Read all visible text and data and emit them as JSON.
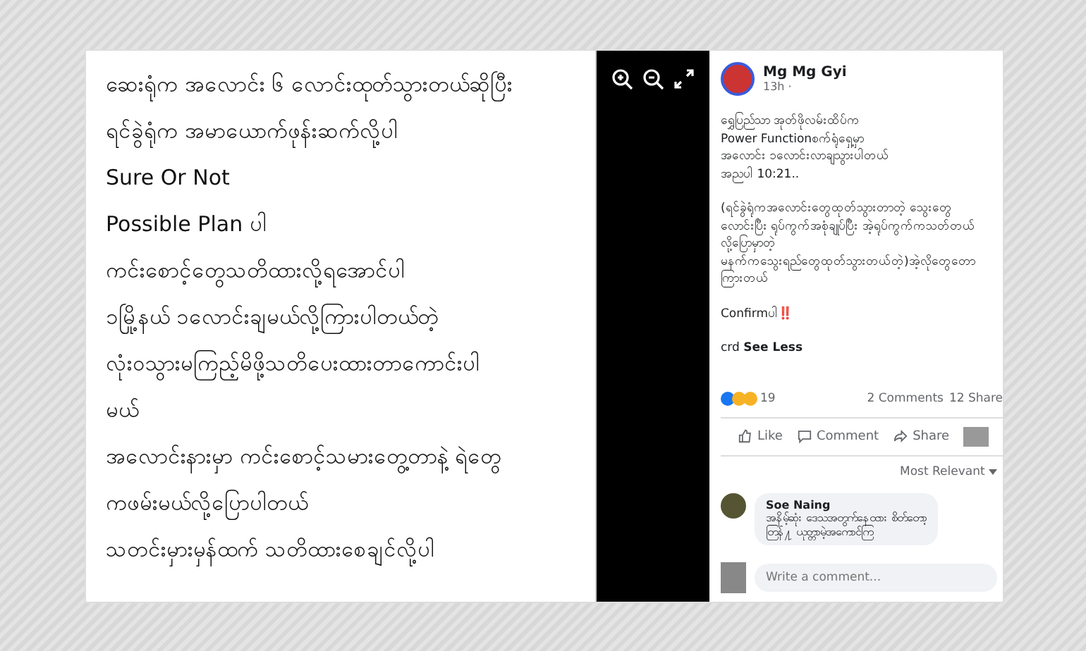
{
  "image_text": [
    "ဆေးရုံက အလောင်း ၆ လောင်းထုတ်သွားတယ်ဆိုပြီး",
    "ရင်ခွဲရုံက အမာယောက်ဖုန်းဆက်လို့ပါ",
    "Sure Or Not",
    "Possible Plan ပါ",
    "ကင်းစောင့်တွေသတိထားလို့ရအောင်ပါ",
    "၁မြို့နယ် ၁လောင်းချမယ်လို့ကြားပါတယ်တဲ့",
    "လုံးဝသွားမကြည့်မိဖို့သတိပေးထားတာကောင်းပါ",
    "မယ်",
    "အလောင်းနားမှာ ကင်းစောင့်သမားတွေ့တာနဲ့ ရဲတွေ",
    "ကဖမ်းမယ်လို့ပြောပါတယ်",
    "သတင်းမှားမှန်ထက် သတိထားစေချင်လို့ပါ"
  ],
  "post": {
    "author": "Mg Mg Gyi",
    "time": "13h ·",
    "paragraphs": [
      "ရွှေပြည်သာ အုတ်ဖိုလမ်းထိပ်က\nPower Functionစက်ရုံရှေ့မှာ\nအလောင်း ၁လောင်းလာချသွားပါတယ်\nအညပါ 10:21..",
      "(ရင်ခွဲရုံကအလောင်းတွေထုတ်သွားတာတဲ့ သွေးတွေ\nလောင်းပြီး ရုပ်ကွက်အစုံချုပ်ပြီး အဲ့ရုပ်ကွက်ကသတ်တယ်\nလို့ပြောမှာတဲ့\nမနက်ကသွေးရည်တွေထုတ်သွားတယ်တဲ့)အဲ့လိုတွေတော\nကြားတယ်",
      "Confirmပါ‼️",
      "crd **See Less**"
    ],
    "reaction_count": "19",
    "comments_count": "2 Comments",
    "shares_count": "12 Share",
    "actions": [
      "Like",
      "Comment",
      "Share"
    ],
    "sort": "Most Relevant",
    "comment": {
      "author": "Soe Naing",
      "text": "အနိမ့်ဆုံး ဒေသအတွက်နေထား စိတ်တော့\nတြန်႔ ယုတ္တာမဲ့အကောင်ကြ"
    },
    "comment_field": {
      "placeholder": "Write a comment..."
    }
  }
}
